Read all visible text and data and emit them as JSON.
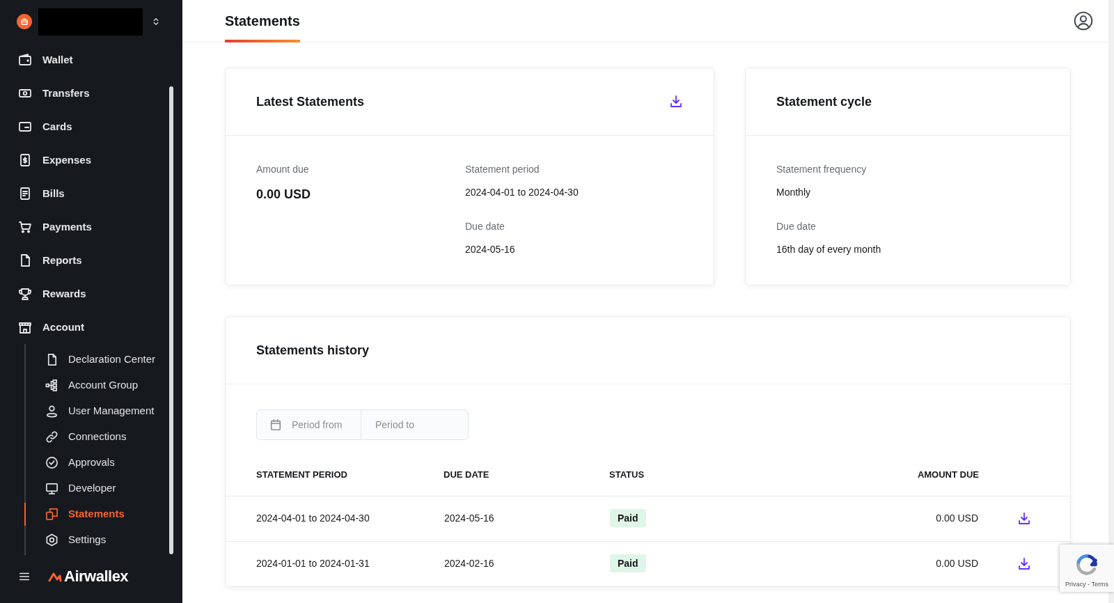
{
  "sidebar": {
    "nav": [
      {
        "label": "Wallet",
        "selected": false
      },
      {
        "label": "Transfers",
        "selected": false
      },
      {
        "label": "Cards",
        "selected": false
      },
      {
        "label": "Expenses",
        "selected": false
      },
      {
        "label": "Bills",
        "selected": false
      },
      {
        "label": "Payments",
        "selected": false
      },
      {
        "label": "Reports",
        "selected": false
      },
      {
        "label": "Rewards",
        "selected": false
      },
      {
        "label": "Account",
        "selected": false,
        "expanded": true,
        "children": [
          {
            "label": "Declaration Center",
            "selected": false
          },
          {
            "label": "Account Group",
            "selected": false
          },
          {
            "label": "User Management",
            "selected": false
          },
          {
            "label": "Connections",
            "selected": false
          },
          {
            "label": "Approvals",
            "selected": false
          },
          {
            "label": "Developer",
            "selected": false
          },
          {
            "label": "Statements",
            "selected": true
          },
          {
            "label": "Settings",
            "selected": false
          }
        ]
      }
    ],
    "brand": "Airwallex"
  },
  "header": {
    "tabs": [
      {
        "label": "Statements",
        "selected": true
      }
    ]
  },
  "latest": {
    "title": "Latest Statements",
    "columns": [
      [
        {
          "label": "Amount due",
          "value": "0.00 USD",
          "kind": "amount"
        }
      ],
      [
        {
          "label": "Statement period",
          "value": "2024-04-01 to 2024-04-30",
          "kind": "text"
        },
        {
          "label": "Due date",
          "value": "2024-05-16",
          "kind": "text"
        }
      ]
    ]
  },
  "cycle": {
    "title": "Statement cycle",
    "fields": [
      {
        "label": "Statement frequency",
        "value": "Monthly"
      },
      {
        "label": "Due date",
        "value": "16th day of every month"
      }
    ]
  },
  "history": {
    "title": "Statements history",
    "filter": {
      "from_placeholder": "Period from",
      "to_placeholder": "Period to"
    },
    "table": {
      "columns": [
        "STATEMENT PERIOD",
        "DUE DATE",
        "STATUS",
        "AMOUNT DUE"
      ],
      "rows": [
        {
          "period": "2024-04-01 to 2024-04-30",
          "due": "2024-05-16",
          "status": "Paid",
          "amount": "0.00 USD"
        },
        {
          "period": "2024-01-01 to 2024-01-31",
          "due": "2024-02-16",
          "status": "Paid",
          "amount": "0.00 USD"
        }
      ]
    }
  },
  "recaptcha": {
    "text": "Privacy - Terms"
  }
}
